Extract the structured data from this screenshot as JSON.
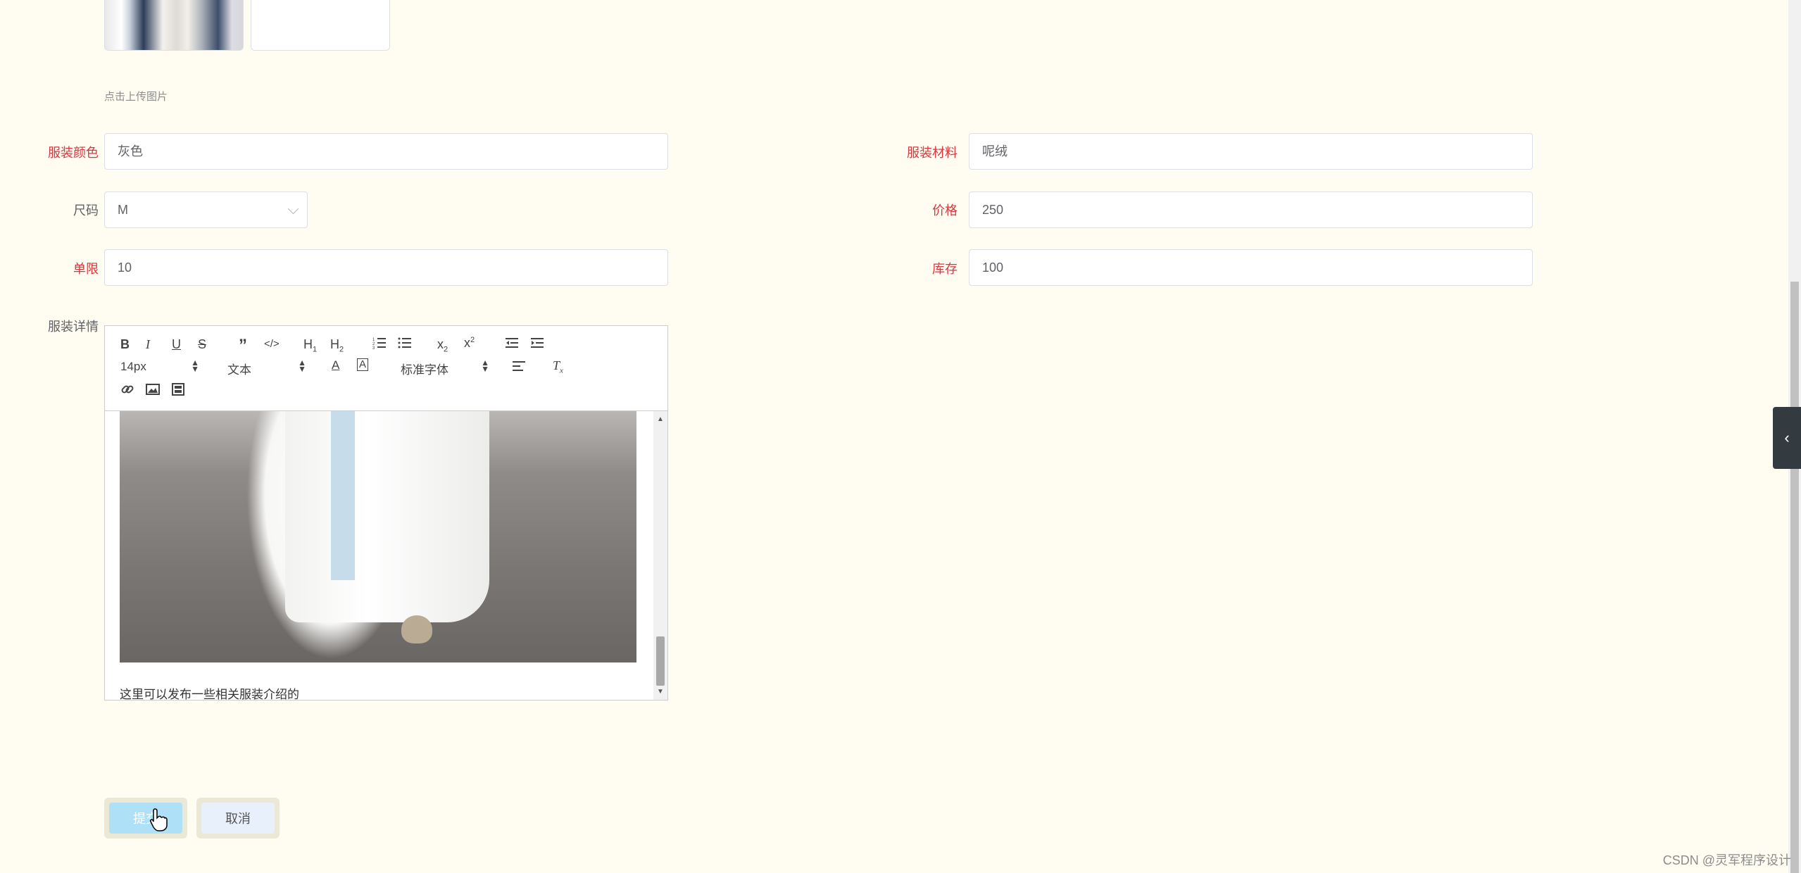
{
  "upload": {
    "hint": "点击上传图片"
  },
  "form": {
    "color": {
      "label": "服装颜色",
      "value": "灰色"
    },
    "material": {
      "label": "服装材料",
      "value": "呢绒"
    },
    "size": {
      "label": "尺码",
      "value": "M"
    },
    "price": {
      "label": "价格",
      "value": "250"
    },
    "limit": {
      "label": "单限",
      "value": "10"
    },
    "stock": {
      "label": "库存",
      "value": "100"
    },
    "details": {
      "label": "服装详情"
    }
  },
  "editor": {
    "font_size": "14px",
    "header": "文本",
    "font_family": "标准字体",
    "content_text": "这里可以发布一些相关服装介绍的"
  },
  "actions": {
    "submit": "提交",
    "cancel": "取消"
  },
  "watermark": "CSDN @灵军程序设计"
}
